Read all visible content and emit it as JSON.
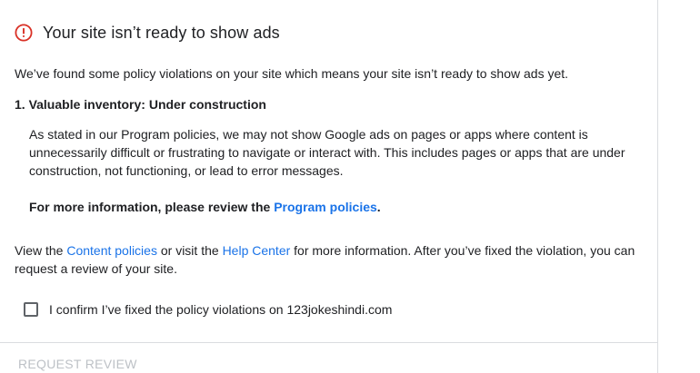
{
  "header": {
    "icon": "alert-circle-icon",
    "icon_color": "#d93025",
    "title": "Your site isn’t ready to show ads"
  },
  "intro": "We’ve found some policy violations on your site which means your site isn’t ready to show ads yet.",
  "violation": {
    "title": "1. Valuable inventory: Under construction",
    "body": "As stated in our Program policies, we may not show Google ads on pages or apps where content is unnecessarily difficult or frustrating to navigate or interact with. This includes pages or apps that are under construction, not functioning, or lead to error messages.",
    "more_info_prefix": "For more information, please review the ",
    "more_info_link": "Program policies",
    "more_info_suffix": "."
  },
  "footer": {
    "text_1": "View the ",
    "link_1": "Content policies",
    "text_2": " or visit the ",
    "link_2": "Help Center",
    "text_3": " for more information. After you’ve fixed the violation, you can request a review of your site."
  },
  "confirm": {
    "checked": false,
    "label": "I confirm I’ve fixed the policy violations on 123jokeshindi.com"
  },
  "actions": {
    "request_review_label": "REQUEST REVIEW",
    "request_review_enabled": false
  },
  "colors": {
    "link": "#1a73e8",
    "alert": "#d93025",
    "disabled": "#bdc1c6",
    "divider": "#dadce0"
  }
}
